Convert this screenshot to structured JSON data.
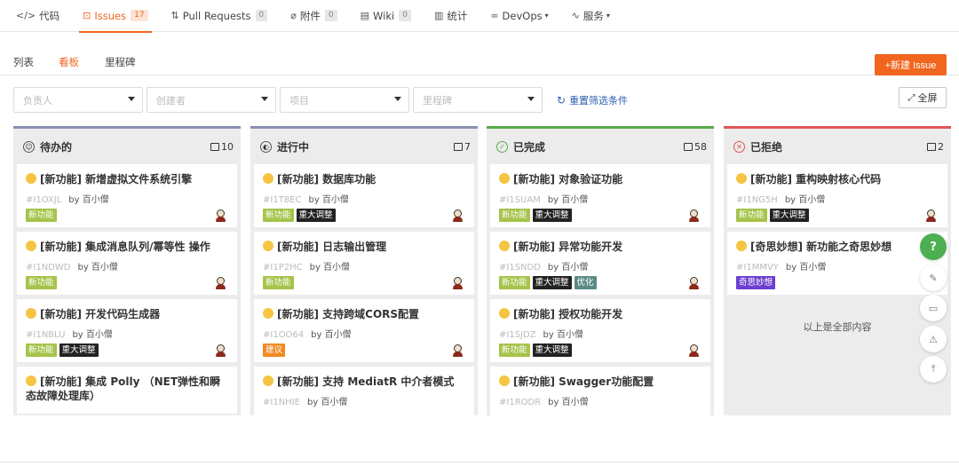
{
  "nav": {
    "tabs": [
      {
        "icon": "</>",
        "label": "代码",
        "count": ""
      },
      {
        "icon": "⊡",
        "label": "Issues",
        "count": "17"
      },
      {
        "icon": "⇅",
        "label": "Pull Requests",
        "count": "0"
      },
      {
        "icon": "⌀",
        "label": "附件",
        "count": "0"
      },
      {
        "icon": "▤",
        "label": "Wiki",
        "count": "0"
      },
      {
        "icon": "▥",
        "label": "统计",
        "count": ""
      },
      {
        "icon": "∞",
        "label": "DevOps",
        "count": ""
      },
      {
        "icon": "∿",
        "label": "服务",
        "count": ""
      }
    ],
    "active_color": "#f0661e"
  },
  "subnav": {
    "list": "列表",
    "board": "看板",
    "milestone": "里程碑",
    "new_issue": "+新建 Issue"
  },
  "filters": {
    "assignee": "负责人",
    "creator": "创建者",
    "project": "项目",
    "milestone": "里程碑",
    "reset": "重置筛选条件",
    "fullscreen": "全屏"
  },
  "label_colors": {
    "新功能": "#a6c34a",
    "重大调整": "#222222",
    "建议": "#f08a24",
    "优化": "#5a8a86",
    "奇思妙想": "#6a3fd1"
  },
  "columns": [
    {
      "title": "待办的",
      "count": "10",
      "accent": "#8a8fb3",
      "status_icon": "☺",
      "cards": [
        {
          "title": "[新功能] 新增虚拟文件系统引擎",
          "id": "#I1OXJL",
          "by": "by 百小僧",
          "labels": [
            "新功能"
          ]
        },
        {
          "title": "[新功能] 集成消息队列/幂等性 操作",
          "id": "#I1NDWD",
          "by": "by 百小僧",
          "labels": [
            "新功能"
          ]
        },
        {
          "title": "[新功能] 开发代码生成器",
          "id": "#I1NBLU",
          "by": "by 百小僧",
          "labels": [
            "新功能",
            "重大调整"
          ]
        },
        {
          "title": "[新功能] 集成 Polly （NET弹性和瞬态故障处理库）",
          "id": "",
          "by": "",
          "labels": []
        }
      ]
    },
    {
      "title": "进行中",
      "count": "7",
      "accent": "#8a8fb3",
      "status_icon": "◐",
      "cards": [
        {
          "title": "[新功能] 数据库功能",
          "id": "#I1T8EC",
          "by": "by 百小僧",
          "labels": [
            "新功能",
            "重大调整"
          ]
        },
        {
          "title": "[新功能] 日志输出管理",
          "id": "#I1P2HC",
          "by": "by 百小僧",
          "labels": [
            "新功能"
          ]
        },
        {
          "title": "[新功能] 支持跨域CORS配置",
          "id": "#I1OO64",
          "by": "by 百小僧",
          "labels": [
            "建议"
          ]
        },
        {
          "title": "[新功能] 支持 MediatR 中介者模式",
          "id": "#I1NHIE",
          "by": "by 百小僧",
          "labels": []
        }
      ]
    },
    {
      "title": "已完成",
      "count": "58",
      "accent": "#5aaa4a",
      "status_icon": "✓",
      "cards": [
        {
          "title": "[新功能] 对象验证功能",
          "id": "#I1SUAM",
          "by": "by 百小僧",
          "labels": [
            "新功能",
            "重大调整"
          ]
        },
        {
          "title": "[新功能] 异常功能开发",
          "id": "#I1SNDD",
          "by": "by 百小僧",
          "labels": [
            "新功能",
            "重大调整",
            "优化"
          ]
        },
        {
          "title": "[新功能] 授权功能开发",
          "id": "#I1SJDZ",
          "by": "by 百小僧",
          "labels": [
            "新功能",
            "重大调整"
          ]
        },
        {
          "title": "[新功能] Swagger功能配置",
          "id": "#I1RODR",
          "by": "by 百小僧",
          "labels": []
        }
      ]
    },
    {
      "title": "已拒绝",
      "count": "2",
      "accent": "#e05555",
      "status_icon": "✕",
      "cards": [
        {
          "title": "[新功能] 重构映射核心代码",
          "id": "#I1NG5H",
          "by": "by 百小僧",
          "labels": [
            "新功能",
            "重大调整"
          ]
        },
        {
          "title": "[奇思妙想] 新功能之奇思妙想",
          "id": "#I1MMVY",
          "by": "by 百小僧",
          "labels": [
            "奇思妙想"
          ]
        }
      ],
      "end_note": "以上是全部内容"
    }
  ],
  "float_buttons": [
    "?",
    "✎",
    "▭",
    "⚠",
    "⤒"
  ]
}
